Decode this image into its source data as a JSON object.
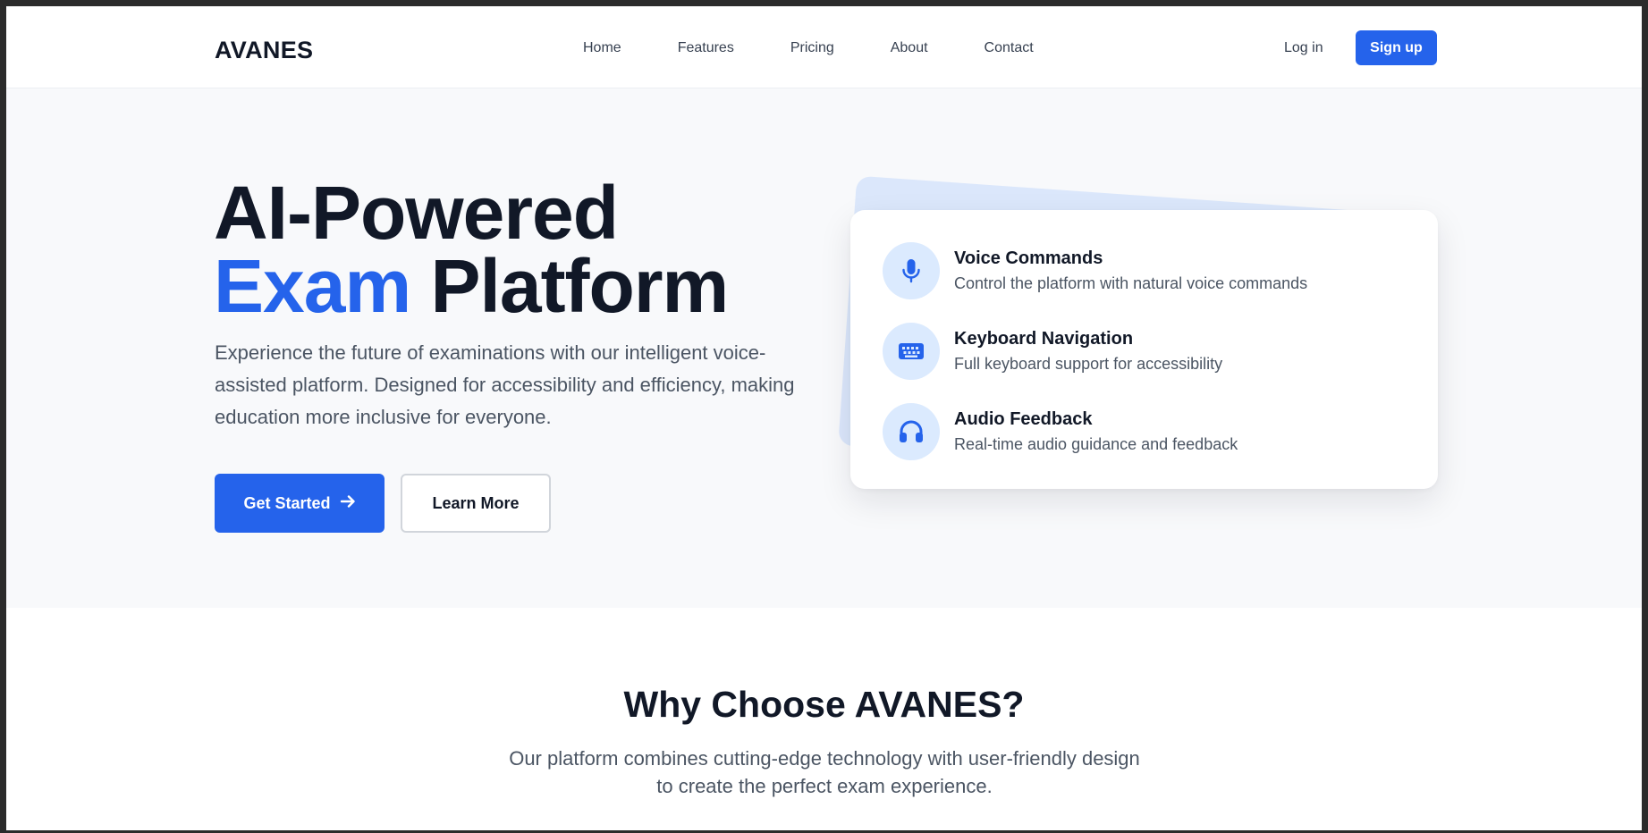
{
  "header": {
    "logo": "AVANES",
    "nav": [
      {
        "label": "Home"
      },
      {
        "label": "Features"
      },
      {
        "label": "Pricing"
      },
      {
        "label": "About"
      },
      {
        "label": "Contact"
      }
    ],
    "login_label": "Log in",
    "signup_label": "Sign up"
  },
  "hero": {
    "title_line1": "AI-Powered",
    "title_accent": "Exam",
    "title_rest": " Platform",
    "description": "Experience the future of examinations with our intelligent voice-assisted platform. Designed for accessibility and efficiency, making education more inclusive for everyone.",
    "primary_button": "Get Started",
    "secondary_button": "Learn More"
  },
  "features": [
    {
      "title": "Voice Commands",
      "description": "Control the platform with natural voice commands",
      "icon": "microphone-icon"
    },
    {
      "title": "Keyboard Navigation",
      "description": "Full keyboard support for accessibility",
      "icon": "keyboard-icon"
    },
    {
      "title": "Audio Feedback",
      "description": "Real-time audio guidance and feedback",
      "icon": "headphones-icon"
    }
  ],
  "why": {
    "title": "Why Choose AVANES?",
    "subtitle_line1": "Our platform combines cutting-edge technology with user-friendly design",
    "subtitle_line2": "to create the perfect exam experience."
  },
  "colors": {
    "accent": "#2563eb",
    "accent_light": "#dbeafe",
    "text_dark": "#111827",
    "text_muted": "#4b5563",
    "hero_bg": "#f8f9fb"
  }
}
